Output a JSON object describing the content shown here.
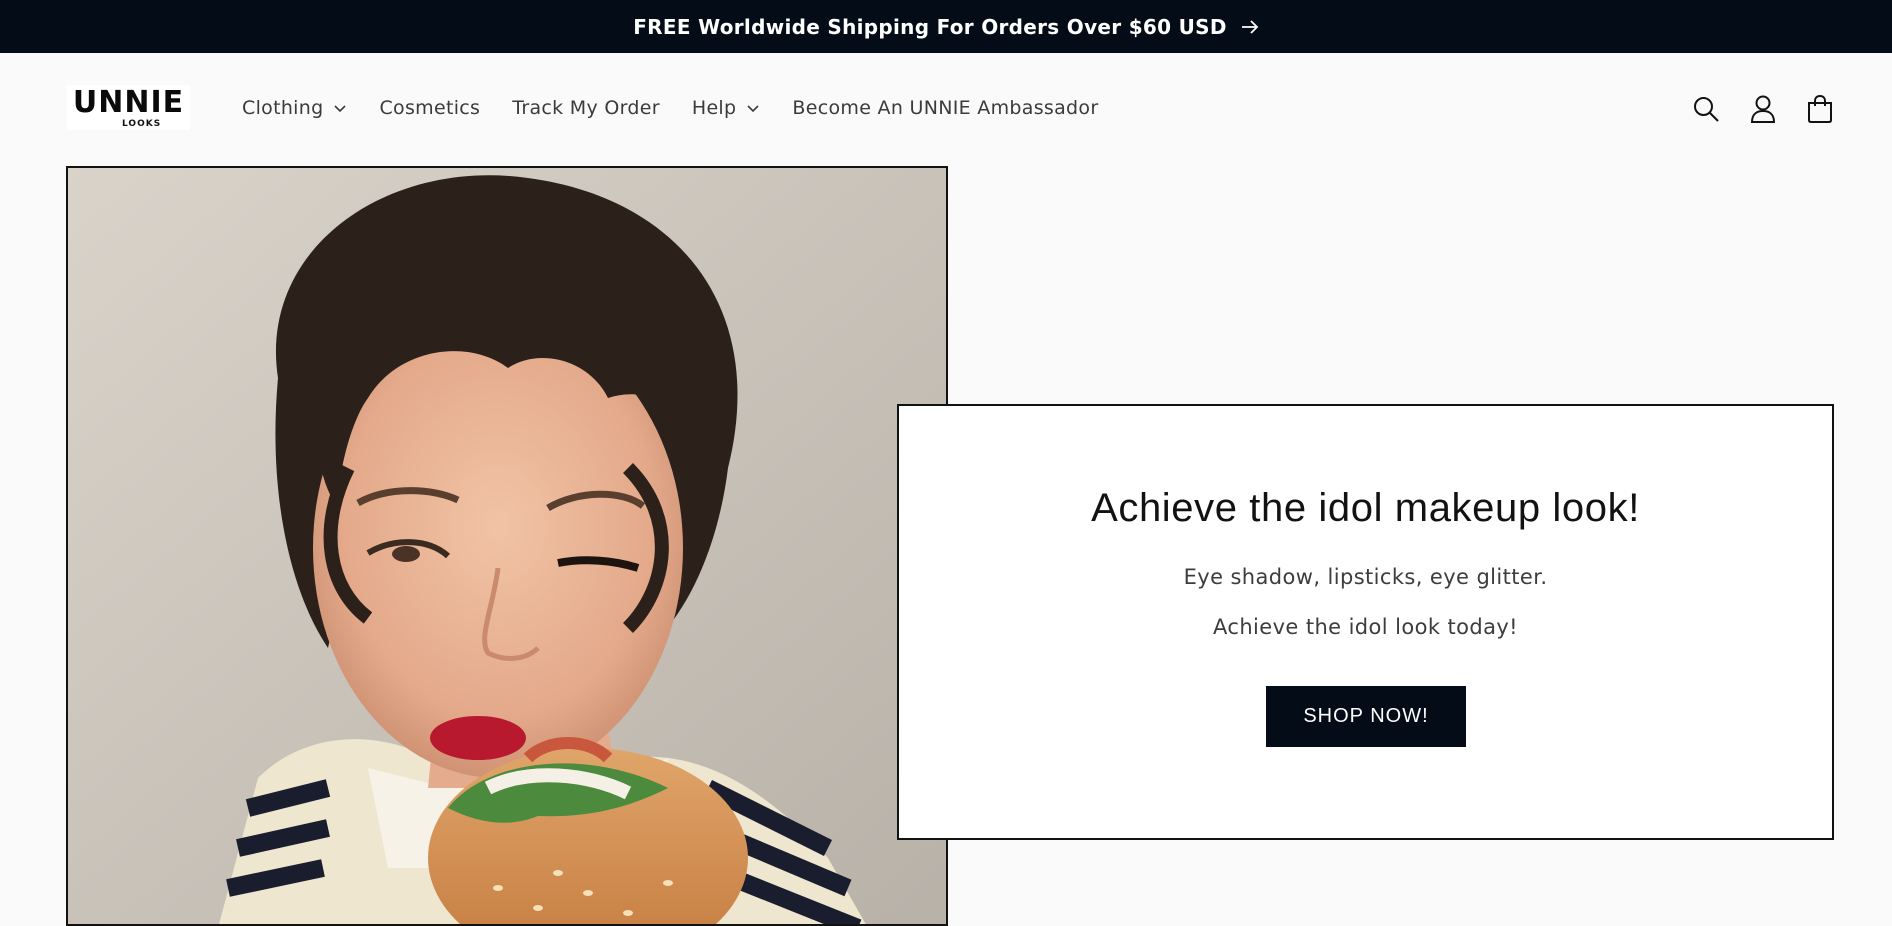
{
  "announcement": {
    "text": "FREE Worldwide Shipping For Orders Over $60 USD",
    "arrow_icon": "arrow-right-icon"
  },
  "brand": {
    "logo_word": "UNNIE",
    "logo_sub": "LOOKS"
  },
  "nav": {
    "items": [
      {
        "label": "Clothing",
        "has_dropdown": true
      },
      {
        "label": "Cosmetics",
        "has_dropdown": false
      },
      {
        "label": "Track My Order",
        "has_dropdown": false
      },
      {
        "label": "Help",
        "has_dropdown": true
      },
      {
        "label": "Become An UNNIE Ambassador",
        "has_dropdown": false
      }
    ]
  },
  "header_icons": [
    "search-icon",
    "account-icon",
    "cart-icon"
  ],
  "hero": {
    "image_subject": "photo of a person with dark curly hair and red lipstick eating a burger, wearing a cream and navy striped cardigan",
    "heading": "Achieve the idol makeup look!",
    "text_line_1": "Eye shadow, lipsticks, eye glitter.",
    "text_line_2": "Achieve the idol look today!",
    "button_label": "SHOP NOW!"
  },
  "colors": {
    "announcement_bg": "#040c17",
    "page_bg": "#fafafa",
    "button_bg": "#040c17",
    "text": "#121212"
  }
}
